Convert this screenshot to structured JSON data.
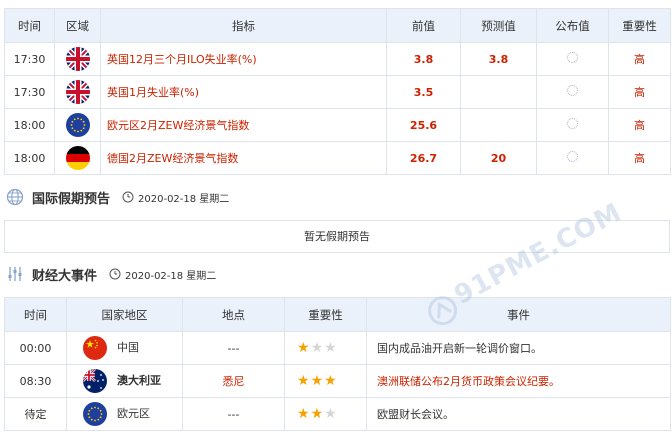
{
  "econ_table": {
    "headers": [
      "时间",
      "区域",
      "指标",
      "前值",
      "预测值",
      "公布值",
      "重要性"
    ],
    "rows": [
      {
        "time": "17:30",
        "flag": "uk",
        "indicator": "英国12月三个月ILO失业率(%)",
        "previous": "3.8",
        "forecast": "3.8",
        "importance": "高"
      },
      {
        "time": "17:30",
        "flag": "uk",
        "indicator": "英国1月失业率(%)",
        "previous": "3.5",
        "forecast": "",
        "importance": "高"
      },
      {
        "time": "18:00",
        "flag": "eu",
        "indicator": "欧元区2月ZEW经济景气指数",
        "previous": "25.6",
        "forecast": "",
        "importance": "高"
      },
      {
        "time": "18:00",
        "flag": "de",
        "indicator": "德国2月ZEW经济景气指数",
        "previous": "26.7",
        "forecast": "20",
        "importance": "高"
      }
    ]
  },
  "holiday_section": {
    "title": "国际假期预告",
    "date": "2020-02-18 星期二",
    "empty_text": "暂无假期预告"
  },
  "events_section": {
    "title": "财经大事件",
    "date": "2020-02-18 星期二",
    "headers": [
      "时间",
      "国家地区",
      "地点",
      "重要性",
      "事件"
    ],
    "rows": [
      {
        "time": "00:00",
        "flag": "cn",
        "country": "中国",
        "location": "---",
        "stars": 1,
        "event": "国内成品油开启新一轮调价窗口。",
        "highlight": false
      },
      {
        "time": "08:30",
        "flag": "au",
        "country": "澳大利亚",
        "location": "悉尼",
        "stars": 3,
        "event": "澳洲联储公布2月货币政策会议纪要。",
        "highlight": true
      },
      {
        "time": "待定",
        "flag": "eu",
        "country": "欧元区",
        "location": "---",
        "stars": 2,
        "event": "欧盟财长会议。",
        "highlight": false
      }
    ]
  },
  "watermark": {
    "text": "91PME.COM"
  },
  "colors": {
    "accent_red": "#cc2200",
    "header_bg": "#eaf1fb",
    "star_on": "#f4a300",
    "star_off": "#d6d6d6"
  }
}
